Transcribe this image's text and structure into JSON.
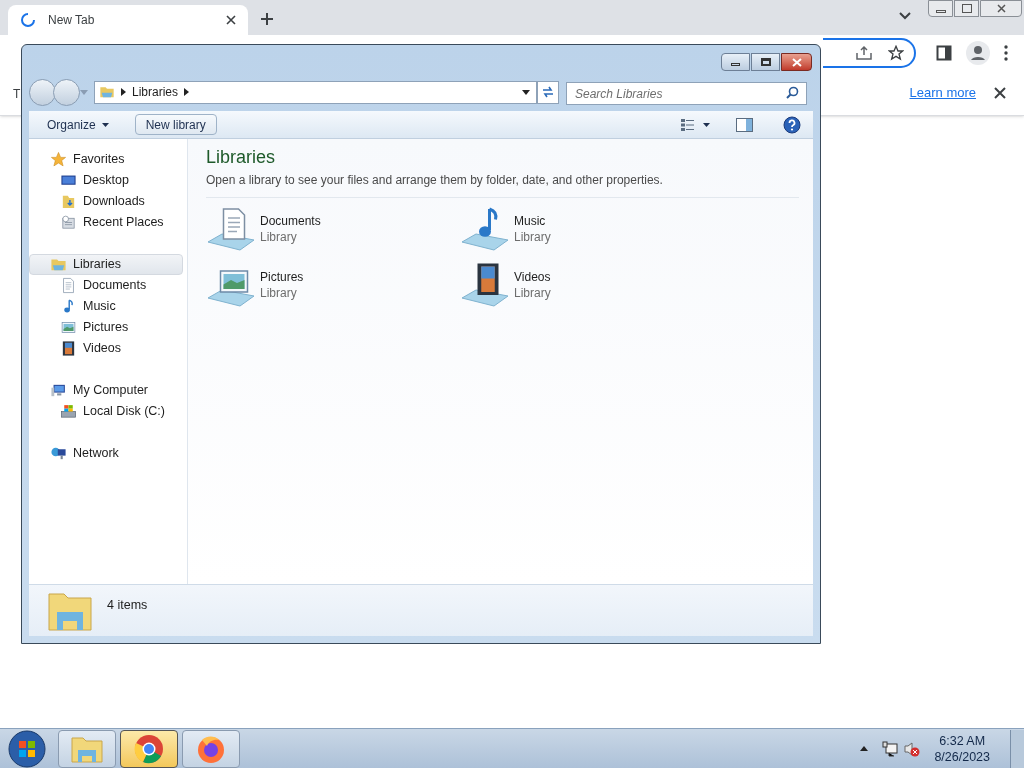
{
  "browser": {
    "tab": {
      "title": "New Tab",
      "loading": true
    },
    "infobar": {
      "text": "T",
      "link": "Learn more"
    }
  },
  "explorer": {
    "breadcrumb": [
      "Libraries"
    ],
    "search": {
      "placeholder": "Search Libraries"
    },
    "toolbar": [
      {
        "label": "Organize",
        "dropdown": true
      },
      {
        "label": "New library",
        "dropdown": false
      }
    ],
    "nav": [
      {
        "label": "Favorites",
        "kind": "star",
        "selected": false,
        "children": [
          {
            "label": "Desktop",
            "kind": "desktop",
            "selected": false
          },
          {
            "label": "Downloads",
            "kind": "downloads",
            "selected": false
          },
          {
            "label": "Recent Places",
            "kind": "recent",
            "selected": false
          }
        ]
      },
      {
        "label": "Libraries",
        "kind": "library",
        "selected": true,
        "children": [
          {
            "label": "Documents",
            "kind": "documents",
            "selected": false
          },
          {
            "label": "Music",
            "kind": "music",
            "selected": false
          },
          {
            "label": "Pictures",
            "kind": "pictures",
            "selected": false
          },
          {
            "label": "Videos",
            "kind": "videos",
            "selected": false
          }
        ]
      },
      {
        "label": "My Computer",
        "kind": "computer",
        "selected": false,
        "children": [
          {
            "label": "Local Disk (C:)",
            "kind": "disk",
            "selected": false
          }
        ]
      },
      {
        "label": "Network",
        "kind": "network",
        "selected": false
      }
    ],
    "content": {
      "title": "Libraries",
      "description": "Open a library to see your files and arrange them by folder, date, and other properties.",
      "items": [
        {
          "name": "Documents",
          "type": "Library",
          "kind": "documents"
        },
        {
          "name": "Music",
          "type": "Library",
          "kind": "music"
        },
        {
          "name": "Pictures",
          "type": "Library",
          "kind": "pictures"
        },
        {
          "name": "Videos",
          "type": "Library",
          "kind": "videos"
        }
      ]
    },
    "status": {
      "text": "4 items"
    }
  },
  "taskbar": {
    "apps": [
      {
        "kind": "explorer",
        "active": false
      },
      {
        "kind": "chrome",
        "active": true
      },
      {
        "kind": "firefox",
        "active": false
      }
    ],
    "clock": {
      "time": "6:32 AM",
      "date": "8/26/2023"
    }
  }
}
